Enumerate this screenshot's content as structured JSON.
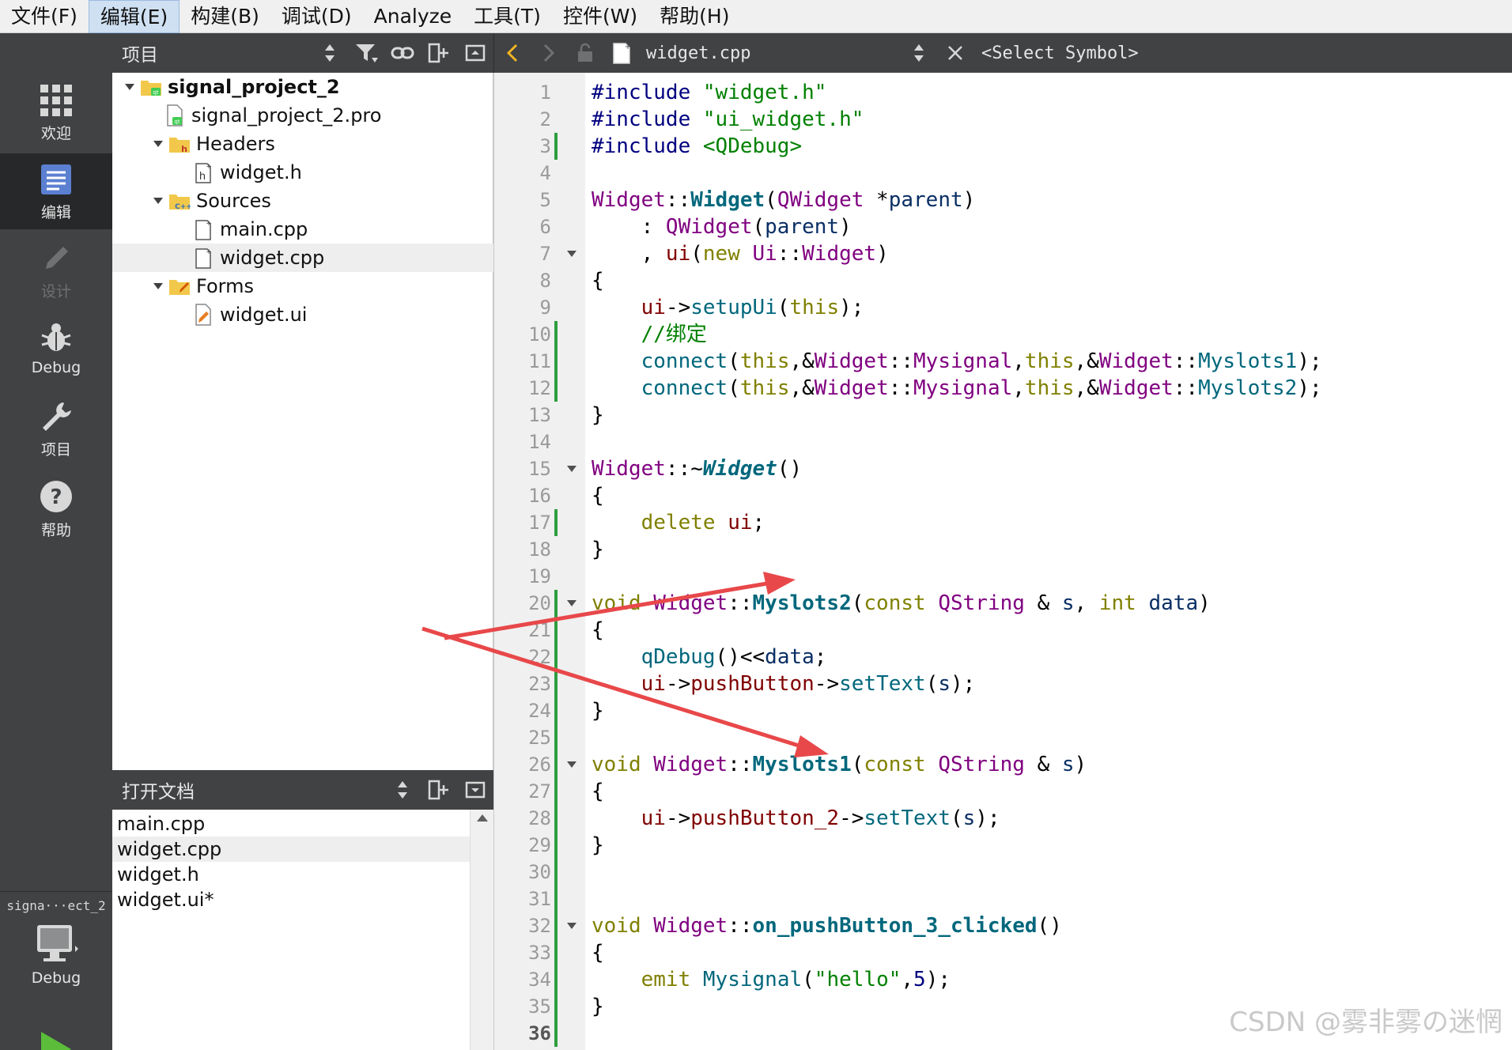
{
  "menu": [
    {
      "label": "文件(F)"
    },
    {
      "label": "编辑(E)"
    },
    {
      "label": "构建(B)"
    },
    {
      "label": "调试(D)"
    },
    {
      "label": "Analyze"
    },
    {
      "label": "工具(T)"
    },
    {
      "label": "控件(W)"
    },
    {
      "label": "帮助(H)"
    }
  ],
  "modes": [
    {
      "label": "欢迎",
      "icon": "grid-icon"
    },
    {
      "label": "编辑",
      "icon": "edit-document-icon"
    },
    {
      "label": "设计",
      "icon": "pencil-icon"
    },
    {
      "label": "Debug",
      "icon": "bug-icon"
    },
    {
      "label": "项目",
      "icon": "wrench-icon"
    },
    {
      "label": "帮助",
      "icon": "help-icon"
    }
  ],
  "kit": {
    "label": "signa···ect_2",
    "mode": "Debug",
    "icon": "monitor-icon",
    "run_icon": "run-icon"
  },
  "project_pane": {
    "title": "项目",
    "tree": [
      {
        "label": "signal_project_2"
      },
      {
        "label": "signal_project_2.pro"
      },
      {
        "label": "Headers"
      },
      {
        "label": "widget.h"
      },
      {
        "label": "Sources"
      },
      {
        "label": "main.cpp"
      },
      {
        "label": "widget.cpp"
      },
      {
        "label": "Forms"
      },
      {
        "label": "widget.ui"
      }
    ]
  },
  "open_docs": {
    "title": "打开文档",
    "items": [
      "main.cpp",
      "widget.cpp",
      "widget.h",
      "widget.ui*"
    ]
  },
  "editor": {
    "file": "widget.cpp",
    "symbol": "<Select Symbol>",
    "current_line": 36,
    "line_numbers": [
      "1",
      "2",
      "3",
      "4",
      "5",
      "6",
      "7",
      "8",
      "9",
      "10",
      "11",
      "12",
      "13",
      "14",
      "15",
      "16",
      "17",
      "18",
      "19",
      "20",
      "21",
      "22",
      "23",
      "24",
      "25",
      "26",
      "27",
      "28",
      "29",
      "30",
      "31",
      "32",
      "33",
      "34",
      "35",
      "36"
    ],
    "lines": [
      [
        [
          "pp",
          "#include "
        ],
        [
          "str",
          "\"widget.h\""
        ]
      ],
      [
        [
          "pp",
          "#include "
        ],
        [
          "str",
          "\"ui_widget.h\""
        ]
      ],
      [
        [
          "pp",
          "#include "
        ],
        [
          "str",
          "<QDebug>"
        ]
      ],
      [],
      [
        [
          "ty",
          "Widget"
        ],
        [
          "op",
          "::"
        ],
        [
          "fnb",
          "Widget"
        ],
        [
          "op",
          "("
        ],
        [
          "ty",
          "QWidget"
        ],
        [
          "op",
          " *"
        ],
        [
          "par",
          "parent"
        ],
        [
          "op",
          ")"
        ]
      ],
      [
        [
          "op",
          "    : "
        ],
        [
          "ty",
          "QWidget"
        ],
        [
          "op",
          "("
        ],
        [
          "par",
          "parent"
        ],
        [
          "op",
          ")"
        ]
      ],
      [
        [
          "op",
          "    , "
        ],
        [
          "mem",
          "ui"
        ],
        [
          "op",
          "("
        ],
        [
          "kw",
          "new"
        ],
        [
          "op",
          " "
        ],
        [
          "ty",
          "Ui"
        ],
        [
          "op",
          "::"
        ],
        [
          "ty",
          "Widget"
        ],
        [
          "op",
          ")"
        ]
      ],
      [
        [
          "op",
          "{"
        ]
      ],
      [
        [
          "op",
          "    "
        ],
        [
          "mem",
          "ui"
        ],
        [
          "op",
          "->"
        ],
        [
          "fn",
          "setupUi"
        ],
        [
          "op",
          "("
        ],
        [
          "kw",
          "this"
        ],
        [
          "op",
          ");"
        ]
      ],
      [
        [
          "op",
          "    "
        ],
        [
          "cm",
          "//绑定"
        ]
      ],
      [
        [
          "op",
          "    "
        ],
        [
          "fn",
          "connect"
        ],
        [
          "op",
          "("
        ],
        [
          "kw",
          "this"
        ],
        [
          "op",
          ",&"
        ],
        [
          "ty",
          "Widget"
        ],
        [
          "op",
          "::"
        ],
        [
          "ty",
          "Mysignal"
        ],
        [
          "op",
          ","
        ],
        [
          "kw",
          "this"
        ],
        [
          "op",
          ",&"
        ],
        [
          "ty",
          "Widget"
        ],
        [
          "op",
          "::"
        ],
        [
          "fn",
          "Myslots1"
        ],
        [
          "op",
          ");"
        ]
      ],
      [
        [
          "op",
          "    "
        ],
        [
          "fn",
          "connect"
        ],
        [
          "op",
          "("
        ],
        [
          "kw",
          "this"
        ],
        [
          "op",
          ",&"
        ],
        [
          "ty",
          "Widget"
        ],
        [
          "op",
          "::"
        ],
        [
          "ty",
          "Mysignal"
        ],
        [
          "op",
          ","
        ],
        [
          "kw",
          "this"
        ],
        [
          "op",
          ",&"
        ],
        [
          "ty",
          "Widget"
        ],
        [
          "op",
          "::"
        ],
        [
          "fn",
          "Myslots2"
        ],
        [
          "op",
          ");"
        ]
      ],
      [
        [
          "op",
          "}"
        ]
      ],
      [],
      [
        [
          "ty",
          "Widget"
        ],
        [
          "op",
          "::~"
        ],
        [
          "fni",
          "Widget"
        ],
        [
          "op",
          "()"
        ]
      ],
      [
        [
          "op",
          "{"
        ]
      ],
      [
        [
          "op",
          "    "
        ],
        [
          "kw",
          "delete"
        ],
        [
          "op",
          " "
        ],
        [
          "mem",
          "ui"
        ],
        [
          "op",
          ";"
        ]
      ],
      [
        [
          "op",
          "}"
        ]
      ],
      [],
      [
        [
          "kw",
          "void"
        ],
        [
          "op",
          " "
        ],
        [
          "ty",
          "Widget"
        ],
        [
          "op",
          "::"
        ],
        [
          "fnb",
          "Myslots2"
        ],
        [
          "op",
          "("
        ],
        [
          "kw",
          "const"
        ],
        [
          "op",
          " "
        ],
        [
          "ty",
          "QString"
        ],
        [
          "op",
          " & "
        ],
        [
          "par",
          "s"
        ],
        [
          "op",
          ", "
        ],
        [
          "kw",
          "int"
        ],
        [
          "op",
          " "
        ],
        [
          "par",
          "data"
        ],
        [
          "op",
          ")"
        ]
      ],
      [
        [
          "op",
          "{"
        ]
      ],
      [
        [
          "op",
          "    "
        ],
        [
          "fn",
          "qDebug"
        ],
        [
          "op",
          "()<<"
        ],
        [
          "par",
          "data"
        ],
        [
          "op",
          ";"
        ]
      ],
      [
        [
          "op",
          "    "
        ],
        [
          "mem",
          "ui"
        ],
        [
          "op",
          "->"
        ],
        [
          "mem",
          "pushButton"
        ],
        [
          "op",
          "->"
        ],
        [
          "fn",
          "setText"
        ],
        [
          "op",
          "("
        ],
        [
          "par",
          "s"
        ],
        [
          "op",
          ");"
        ]
      ],
      [
        [
          "op",
          "}"
        ]
      ],
      [],
      [
        [
          "kw",
          "void"
        ],
        [
          "op",
          " "
        ],
        [
          "ty",
          "Widget"
        ],
        [
          "op",
          "::"
        ],
        [
          "fnb",
          "Myslots1"
        ],
        [
          "op",
          "("
        ],
        [
          "kw",
          "const"
        ],
        [
          "op",
          " "
        ],
        [
          "ty",
          "QString"
        ],
        [
          "op",
          " & "
        ],
        [
          "par",
          "s"
        ],
        [
          "op",
          ")"
        ]
      ],
      [
        [
          "op",
          "{"
        ]
      ],
      [
        [
          "op",
          "    "
        ],
        [
          "mem",
          "ui"
        ],
        [
          "op",
          "->"
        ],
        [
          "mem",
          "pushButton_2"
        ],
        [
          "op",
          "->"
        ],
        [
          "fn",
          "setText"
        ],
        [
          "op",
          "("
        ],
        [
          "par",
          "s"
        ],
        [
          "op",
          ");"
        ]
      ],
      [
        [
          "op",
          "}"
        ]
      ],
      [],
      [],
      [
        [
          "kw",
          "void"
        ],
        [
          "op",
          " "
        ],
        [
          "ty",
          "Widget"
        ],
        [
          "op",
          "::"
        ],
        [
          "fnb",
          "on_pushButton_3_clicked"
        ],
        [
          "op",
          "()"
        ]
      ],
      [
        [
          "op",
          "{"
        ]
      ],
      [
        [
          "op",
          "    "
        ],
        [
          "kw",
          "emit"
        ],
        [
          "op",
          " "
        ],
        [
          "fn",
          "Mysignal"
        ],
        [
          "op",
          "("
        ],
        [
          "str",
          "\"hello\""
        ],
        [
          "op",
          ","
        ],
        [
          "num",
          "5"
        ],
        [
          "op",
          ");"
        ]
      ],
      [
        [
          "op",
          "}"
        ]
      ],
      []
    ]
  },
  "colors": {
    "annotation_arrow": "#e8484a",
    "change_bar": "#2e9e3e"
  },
  "watermark": "CSDN @雾非雾の迷惘"
}
